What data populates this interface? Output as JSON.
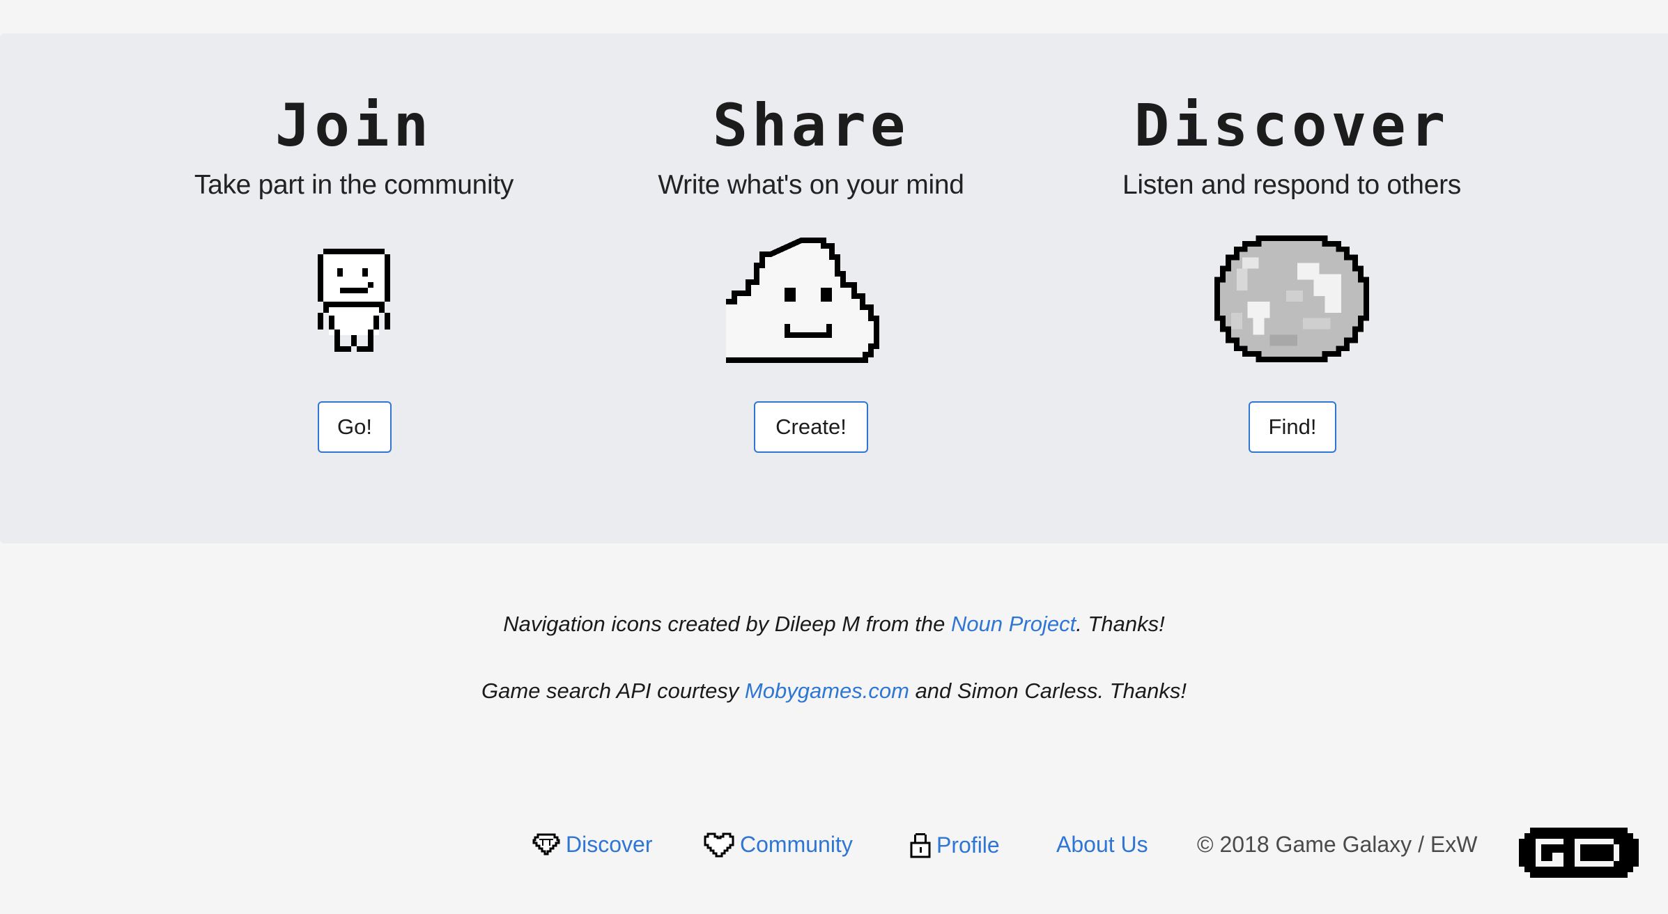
{
  "sections": [
    {
      "title": "Join",
      "subtitle": "Take part in the community",
      "icon": "pixel-person-icon",
      "button": "Go!"
    },
    {
      "title": "Share",
      "subtitle": "Write what's on your mind",
      "icon": "pixel-cloud-icon",
      "button": "Create!"
    },
    {
      "title": "Discover",
      "subtitle": "Listen and respond to others",
      "icon": "pixel-globe-icon",
      "button": "Find!"
    }
  ],
  "credits": {
    "line1_before": "Navigation icons created by Dileep M from the ",
    "line1_link": "Noun Project",
    "line1_after": ". Thanks!",
    "line2_before": "Game search API courtesy ",
    "line2_link": "Mobygames.com",
    "line2_after": " and Simon Carless. Thanks!"
  },
  "footer": {
    "discover": "Discover",
    "community": "Community",
    "profile": "Profile",
    "about": "About Us",
    "copyright": "© 2018 Game Galaxy / ExW",
    "logo_icon": "game-galaxy-logo"
  },
  "colors": {
    "link": "#2f76d4",
    "jumbotron_bg": "#ebecef",
    "page_bg": "#f5f5f5"
  }
}
